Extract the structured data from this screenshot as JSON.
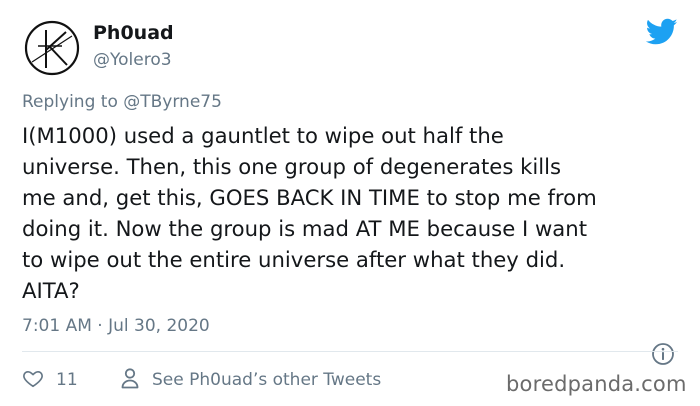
{
  "author": {
    "display_name": "Ph0uad",
    "handle": "@Yolero3",
    "avatar_icon": "k-monogram-avatar-icon"
  },
  "brand": {
    "icon": "twitter-bird-icon",
    "color": "#1da1f2"
  },
  "reply_context": {
    "prefix": "Replying to ",
    "mention": "@TByrne75"
  },
  "tweet": {
    "lines": [
      "I(M1000) used a gauntlet to wipe out half the",
      "universe. Then, this one group of degenerates kills",
      "me and, get this, GOES BACK IN TIME to stop me from",
      "doing it. Now the group is mad AT ME because I want",
      "to wipe out the entire universe after what they did.",
      "AITA?"
    ],
    "timestamp": "7:01 AM · Jul 30, 2020"
  },
  "actions": {
    "like_count": "11",
    "like_icon": "heart-icon",
    "other_tweets_label": "See Ph0uad’s other Tweets",
    "other_tweets_icon": "person-icon",
    "info_icon": "info-icon"
  },
  "watermark": {
    "text": "boredpanda.com"
  },
  "colors": {
    "text_primary": "#14171a",
    "text_secondary": "#657786",
    "divider": "#e1e8ed"
  }
}
